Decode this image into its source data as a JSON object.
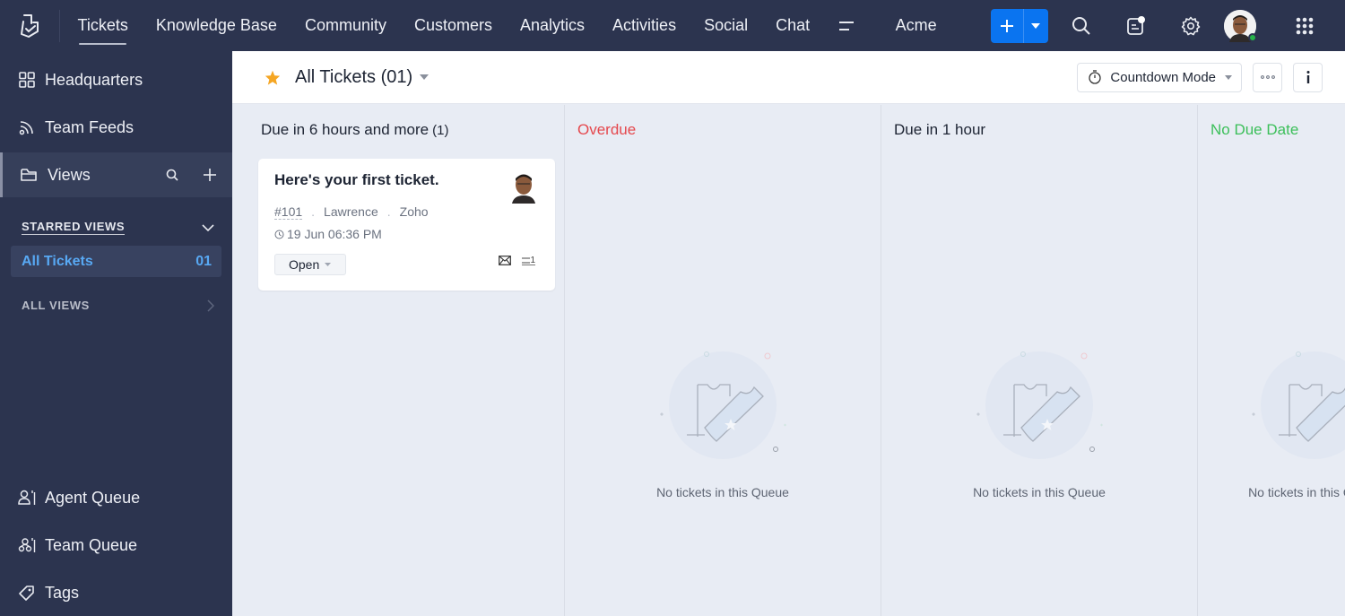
{
  "topbar": {
    "nav": [
      "Tickets",
      "Knowledge Base",
      "Community",
      "Customers",
      "Analytics",
      "Activities",
      "Social",
      "Chat"
    ],
    "active_nav": "Tickets",
    "org": "Acme",
    "accent": "#0a74f0"
  },
  "sidebar": {
    "items": [
      {
        "label": "Headquarters",
        "icon": "grid-icon"
      },
      {
        "label": "Team Feeds",
        "icon": "feed-icon"
      },
      {
        "label": "Views",
        "icon": "folder-icon"
      }
    ],
    "starred_header": "STARRED VIEWS",
    "starred_items": [
      {
        "label": "All Tickets",
        "count": "01"
      }
    ],
    "all_views": "ALL VIEWS",
    "bottom_items": [
      {
        "label": "Agent Queue",
        "icon": "agent-queue-icon"
      },
      {
        "label": "Team Queue",
        "icon": "team-queue-icon"
      },
      {
        "label": "Tags",
        "icon": "tag-icon"
      }
    ]
  },
  "header": {
    "title": "All Tickets (01)",
    "mode": "Countdown Mode"
  },
  "columns": [
    {
      "title": "Due in 6 hours and more",
      "count": "(1)",
      "color": "#1d2433"
    },
    {
      "title": "Overdue",
      "color": "#e5484d"
    },
    {
      "title": "Due in 1 hour",
      "color": "#1d2433"
    },
    {
      "title": "No Due Date",
      "color": "#3cbf5a"
    }
  ],
  "ticket": {
    "subject": "Here's your first ticket.",
    "id": "#101",
    "contact": "Lawrence",
    "account": "Zoho",
    "time": "19 Jun 06:36 PM",
    "status": "Open",
    "thread_count": "1"
  },
  "empty_message": "No tickets in this Queue"
}
